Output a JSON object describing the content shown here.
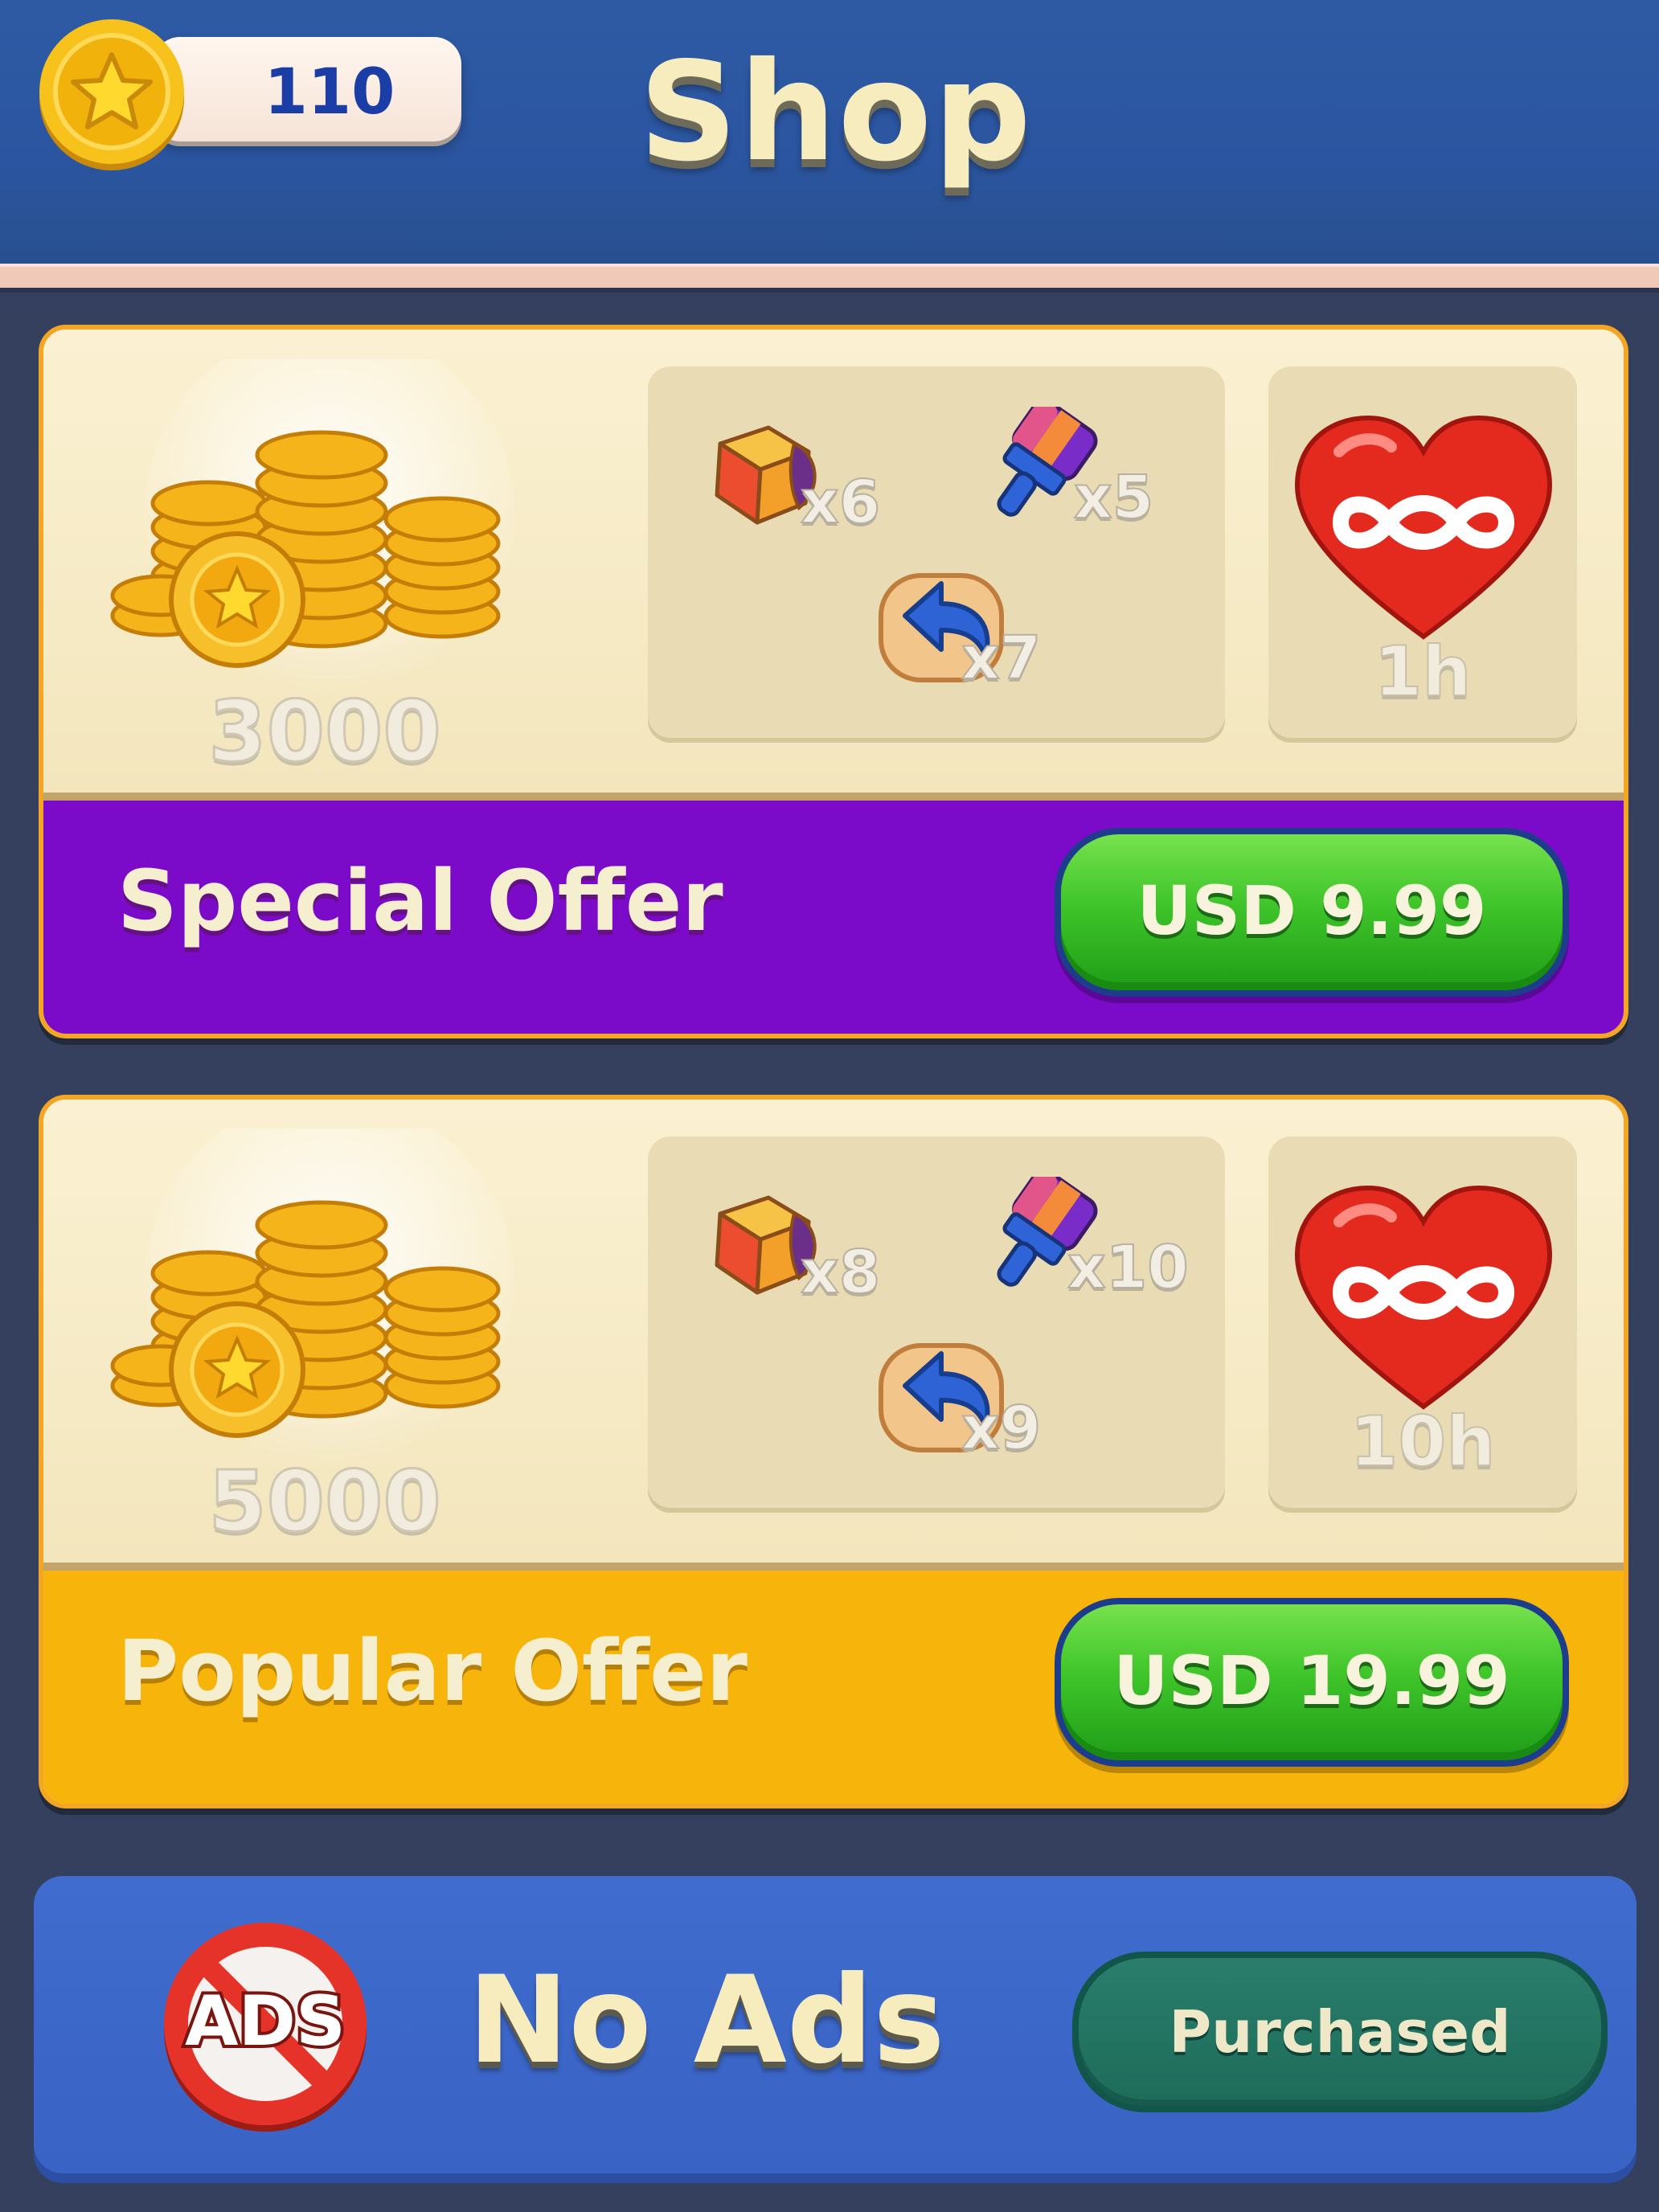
{
  "header": {
    "coins": "110",
    "title": "Shop"
  },
  "offers": [
    {
      "title": "Special Offer",
      "coins": "3000",
      "items": {
        "cube": "x6",
        "brush": "x5",
        "undo": "x7"
      },
      "hearts": "1h",
      "price": "USD 9.99",
      "color": "#7b0bc9"
    },
    {
      "title": "Popular Offer",
      "coins": "5000",
      "items": {
        "cube": "x8",
        "brush": "x10",
        "undo": "x9"
      },
      "hearts": "10h",
      "price": "USD 19.99",
      "color": "#f7b40a"
    }
  ],
  "no_ads": {
    "icon_label": "ADS",
    "title": "No Ads",
    "button": "Purchased"
  },
  "icons": {
    "coin": "star-coin-icon",
    "coin_pile": "coin-pile-icon",
    "cube": "color-cube-icon",
    "brush": "paint-brush-icon",
    "undo": "undo-arrow-icon",
    "heart": "infinite-heart-icon",
    "no_ads": "no-ads-icon"
  },
  "colors": {
    "header_bg": "#2b55a0",
    "background": "#34405e",
    "price_button": "#3fc52a",
    "purchased_button": "#1e6b5a",
    "no_ads_bg": "#3963c4"
  }
}
